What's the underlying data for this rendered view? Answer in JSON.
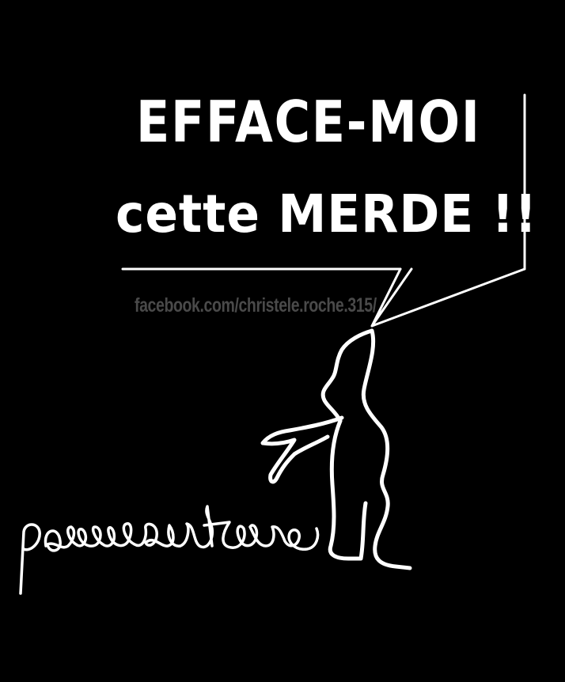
{
  "speech_bubble": {
    "line1": "EFFACE-MOI",
    "line2": "cette MERDE !!"
  },
  "watermark": "facebook.com/christele.roche.315/",
  "handwriting": "pass sanitaire",
  "colors": {
    "background": "#000000",
    "foreground": "#ffffff",
    "watermark": "#4a4a4a"
  }
}
